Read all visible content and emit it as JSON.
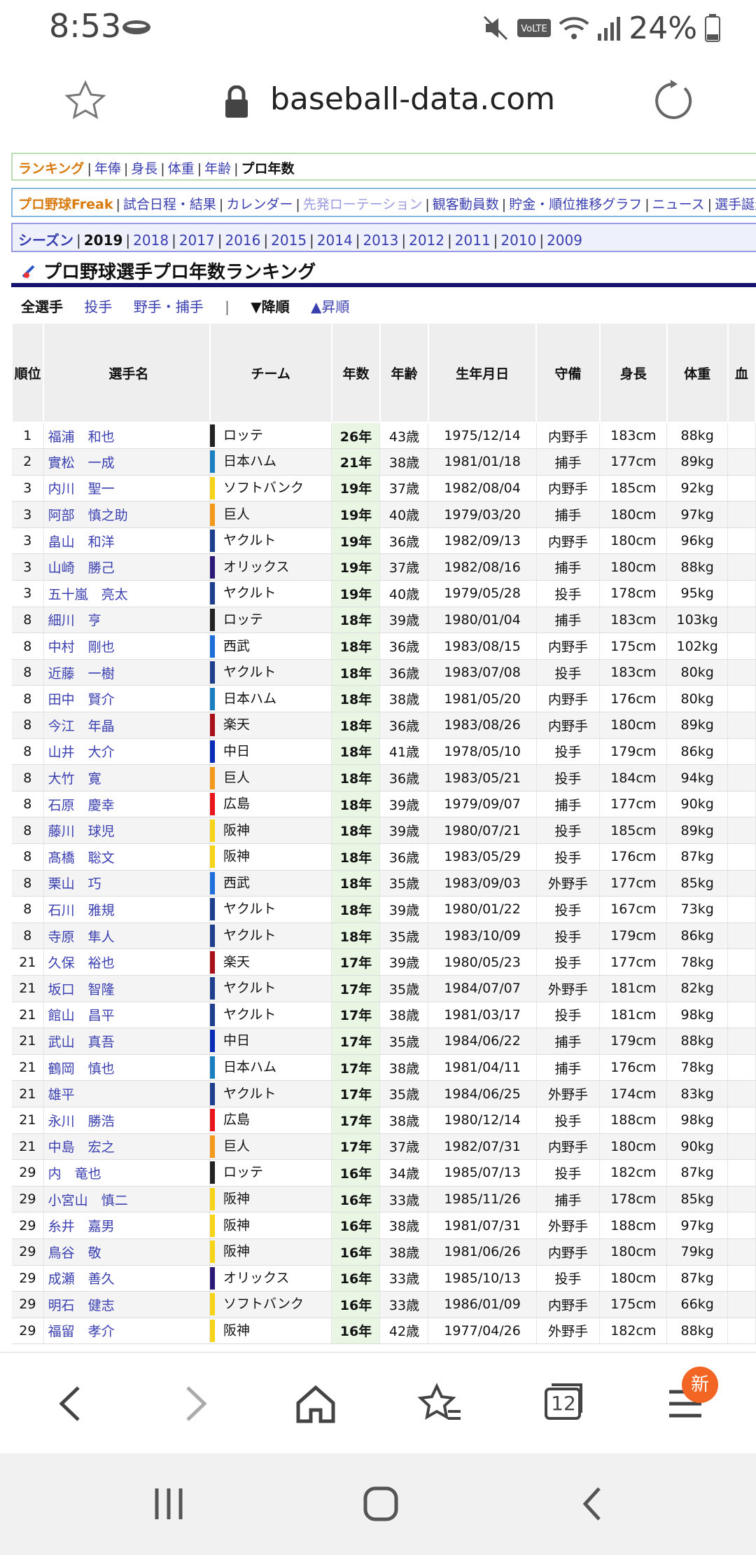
{
  "status_bar": {
    "time": "8:53",
    "battery": "24%"
  },
  "browser": {
    "domain": "baseball-data.com",
    "tab_count": "12",
    "menu_badge": "新"
  },
  "nav1": {
    "ranking": "ランキング",
    "items": [
      "年俸",
      "身長",
      "体重",
      "年齢"
    ],
    "current": "プロ年数"
  },
  "nav2": {
    "brand": "プロ野球Freak",
    "items": [
      "試合日程・結果",
      "カレンダー",
      "先発ローテーション",
      "観客動員数",
      "貯金・順位推移グラフ",
      "ニュース",
      "選手誕生日"
    ]
  },
  "nav3": {
    "label": "シーズン",
    "current": "2019",
    "years": [
      "2018",
      "2017",
      "2016",
      "2015",
      "2014",
      "2013",
      "2012",
      "2011",
      "2010",
      "2009"
    ]
  },
  "page_title": "プロ野球選手プロ年数ランキング",
  "filters": {
    "all": "全選手",
    "pitcher": "投手",
    "fielder": "野手・捕手",
    "divider": "|",
    "desc": "▼降順",
    "asc": "▲昇順"
  },
  "table": {
    "headers": {
      "rank": "順位",
      "name": "選手名",
      "team": "チーム",
      "years": "年数",
      "age": "年齢",
      "birth": "生年月日",
      "pos": "守備",
      "height": "身長",
      "weight": "体重",
      "blood": "血"
    },
    "rows": [
      {
        "rank": "1",
        "name": "福浦　和也",
        "team": "ロッテ",
        "years": "26年",
        "age": "43歳",
        "birth": "1975/12/14",
        "pos": "内野手",
        "height": "183cm",
        "weight": "88kg"
      },
      {
        "rank": "2",
        "name": "實松　一成",
        "team": "日本ハム",
        "years": "21年",
        "age": "38歳",
        "birth": "1981/01/18",
        "pos": "捕手",
        "height": "177cm",
        "weight": "89kg"
      },
      {
        "rank": "3",
        "name": "内川　聖一",
        "team": "ソフトバンク",
        "years": "19年",
        "age": "37歳",
        "birth": "1982/08/04",
        "pos": "内野手",
        "height": "185cm",
        "weight": "92kg"
      },
      {
        "rank": "3",
        "name": "阿部　慎之助",
        "team": "巨人",
        "years": "19年",
        "age": "40歳",
        "birth": "1979/03/20",
        "pos": "捕手",
        "height": "180cm",
        "weight": "97kg"
      },
      {
        "rank": "3",
        "name": "畠山　和洋",
        "team": "ヤクルト",
        "years": "19年",
        "age": "36歳",
        "birth": "1982/09/13",
        "pos": "内野手",
        "height": "180cm",
        "weight": "96kg"
      },
      {
        "rank": "3",
        "name": "山崎　勝己",
        "team": "オリックス",
        "years": "19年",
        "age": "37歳",
        "birth": "1982/08/16",
        "pos": "捕手",
        "height": "180cm",
        "weight": "88kg"
      },
      {
        "rank": "3",
        "name": "五十嵐　亮太",
        "team": "ヤクルト",
        "years": "19年",
        "age": "40歳",
        "birth": "1979/05/28",
        "pos": "投手",
        "height": "178cm",
        "weight": "95kg"
      },
      {
        "rank": "8",
        "name": "細川　亨",
        "team": "ロッテ",
        "years": "18年",
        "age": "39歳",
        "birth": "1980/01/04",
        "pos": "捕手",
        "height": "183cm",
        "weight": "103kg"
      },
      {
        "rank": "8",
        "name": "中村　剛也",
        "team": "西武",
        "years": "18年",
        "age": "36歳",
        "birth": "1983/08/15",
        "pos": "内野手",
        "height": "175cm",
        "weight": "102kg"
      },
      {
        "rank": "8",
        "name": "近藤　一樹",
        "team": "ヤクルト",
        "years": "18年",
        "age": "36歳",
        "birth": "1983/07/08",
        "pos": "投手",
        "height": "183cm",
        "weight": "80kg"
      },
      {
        "rank": "8",
        "name": "田中　賢介",
        "team": "日本ハム",
        "years": "18年",
        "age": "38歳",
        "birth": "1981/05/20",
        "pos": "内野手",
        "height": "176cm",
        "weight": "80kg"
      },
      {
        "rank": "8",
        "name": "今江　年晶",
        "team": "楽天",
        "years": "18年",
        "age": "36歳",
        "birth": "1983/08/26",
        "pos": "内野手",
        "height": "180cm",
        "weight": "89kg"
      },
      {
        "rank": "8",
        "name": "山井　大介",
        "team": "中日",
        "years": "18年",
        "age": "41歳",
        "birth": "1978/05/10",
        "pos": "投手",
        "height": "179cm",
        "weight": "86kg"
      },
      {
        "rank": "8",
        "name": "大竹　寛",
        "team": "巨人",
        "years": "18年",
        "age": "36歳",
        "birth": "1983/05/21",
        "pos": "投手",
        "height": "184cm",
        "weight": "94kg"
      },
      {
        "rank": "8",
        "name": "石原　慶幸",
        "team": "広島",
        "years": "18年",
        "age": "39歳",
        "birth": "1979/09/07",
        "pos": "捕手",
        "height": "177cm",
        "weight": "90kg"
      },
      {
        "rank": "8",
        "name": "藤川　球児",
        "team": "阪神",
        "years": "18年",
        "age": "39歳",
        "birth": "1980/07/21",
        "pos": "投手",
        "height": "185cm",
        "weight": "89kg"
      },
      {
        "rank": "8",
        "name": "髙橋　聡文",
        "team": "阪神",
        "years": "18年",
        "age": "36歳",
        "birth": "1983/05/29",
        "pos": "投手",
        "height": "176cm",
        "weight": "87kg"
      },
      {
        "rank": "8",
        "name": "栗山　巧",
        "team": "西武",
        "years": "18年",
        "age": "35歳",
        "birth": "1983/09/03",
        "pos": "外野手",
        "height": "177cm",
        "weight": "85kg"
      },
      {
        "rank": "8",
        "name": "石川　雅規",
        "team": "ヤクルト",
        "years": "18年",
        "age": "39歳",
        "birth": "1980/01/22",
        "pos": "投手",
        "height": "167cm",
        "weight": "73kg"
      },
      {
        "rank": "8",
        "name": "寺原　隼人",
        "team": "ヤクルト",
        "years": "18年",
        "age": "35歳",
        "birth": "1983/10/09",
        "pos": "投手",
        "height": "179cm",
        "weight": "86kg"
      },
      {
        "rank": "21",
        "name": "久保　裕也",
        "team": "楽天",
        "years": "17年",
        "age": "39歳",
        "birth": "1980/05/23",
        "pos": "投手",
        "height": "177cm",
        "weight": "78kg"
      },
      {
        "rank": "21",
        "name": "坂口　智隆",
        "team": "ヤクルト",
        "years": "17年",
        "age": "35歳",
        "birth": "1984/07/07",
        "pos": "外野手",
        "height": "181cm",
        "weight": "82kg"
      },
      {
        "rank": "21",
        "name": "館山　昌平",
        "team": "ヤクルト",
        "years": "17年",
        "age": "38歳",
        "birth": "1981/03/17",
        "pos": "投手",
        "height": "181cm",
        "weight": "98kg"
      },
      {
        "rank": "21",
        "name": "武山　真吾",
        "team": "中日",
        "years": "17年",
        "age": "35歳",
        "birth": "1984/06/22",
        "pos": "捕手",
        "height": "179cm",
        "weight": "88kg"
      },
      {
        "rank": "21",
        "name": "鶴岡　慎也",
        "team": "日本ハム",
        "years": "17年",
        "age": "38歳",
        "birth": "1981/04/11",
        "pos": "捕手",
        "height": "176cm",
        "weight": "78kg"
      },
      {
        "rank": "21",
        "name": "雄平",
        "team": "ヤクルト",
        "years": "17年",
        "age": "35歳",
        "birth": "1984/06/25",
        "pos": "外野手",
        "height": "174cm",
        "weight": "83kg"
      },
      {
        "rank": "21",
        "name": "永川　勝浩",
        "team": "広島",
        "years": "17年",
        "age": "38歳",
        "birth": "1980/12/14",
        "pos": "投手",
        "height": "188cm",
        "weight": "98kg"
      },
      {
        "rank": "21",
        "name": "中島　宏之",
        "team": "巨人",
        "years": "17年",
        "age": "37歳",
        "birth": "1982/07/31",
        "pos": "内野手",
        "height": "180cm",
        "weight": "90kg"
      },
      {
        "rank": "29",
        "name": "内　竜也",
        "team": "ロッテ",
        "years": "16年",
        "age": "34歳",
        "birth": "1985/07/13",
        "pos": "投手",
        "height": "182cm",
        "weight": "87kg"
      },
      {
        "rank": "29",
        "name": "小宮山　慎二",
        "team": "阪神",
        "years": "16年",
        "age": "33歳",
        "birth": "1985/11/26",
        "pos": "捕手",
        "height": "178cm",
        "weight": "85kg"
      },
      {
        "rank": "29",
        "name": "糸井　嘉男",
        "team": "阪神",
        "years": "16年",
        "age": "38歳",
        "birth": "1981/07/31",
        "pos": "外野手",
        "height": "188cm",
        "weight": "97kg"
      },
      {
        "rank": "29",
        "name": "鳥谷　敬",
        "team": "阪神",
        "years": "16年",
        "age": "38歳",
        "birth": "1981/06/26",
        "pos": "内野手",
        "height": "180cm",
        "weight": "79kg"
      },
      {
        "rank": "29",
        "name": "成瀬　善久",
        "team": "オリックス",
        "years": "16年",
        "age": "33歳",
        "birth": "1985/10/13",
        "pos": "投手",
        "height": "180cm",
        "weight": "87kg"
      },
      {
        "rank": "29",
        "name": "明石　健志",
        "team": "ソフトバンク",
        "years": "16年",
        "age": "33歳",
        "birth": "1986/01/09",
        "pos": "内野手",
        "height": "175cm",
        "weight": "66kg"
      },
      {
        "rank": "29",
        "name": "福留　孝介",
        "team": "阪神",
        "years": "16年",
        "age": "42歳",
        "birth": "1977/04/26",
        "pos": "外野手",
        "height": "182cm",
        "weight": "88kg"
      }
    ]
  },
  "team_colors": {
    "ロッテ": "#222222",
    "日本ハム": "#1a7fc0",
    "ソフトバンク": "#f7d417",
    "巨人": "#f39a1e",
    "ヤクルト": "#1e3f8e",
    "オリックス": "#2b1877",
    "西武": "#1e6fd9",
    "楽天": "#a8101a",
    "中日": "#0a2bb8",
    "広島": "#e8151b",
    "阪神": "#f7d417"
  }
}
